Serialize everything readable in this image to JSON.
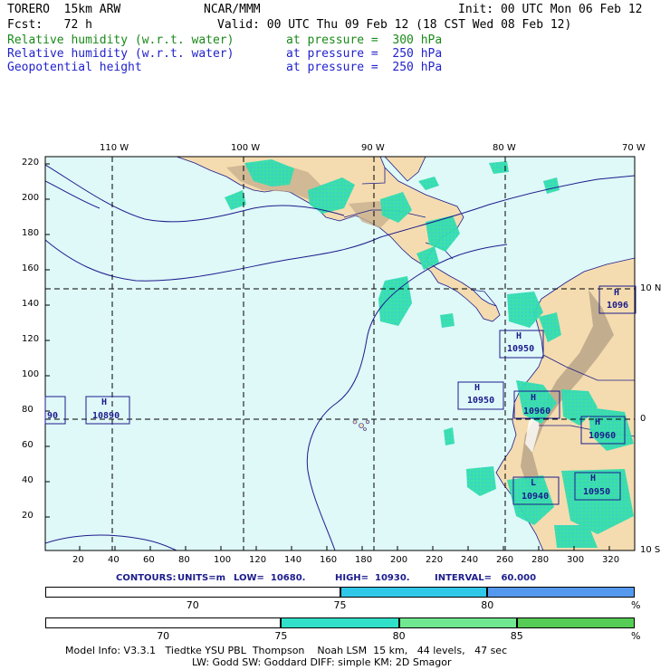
{
  "header": {
    "model": "TORERO  15km ARW",
    "org": "NCAR/MMM",
    "init": "Init: 00 UTC Mon 06 Feb 12",
    "fcst": "Fcst:   72 h",
    "valid": "Valid: 00 UTC Thu 09 Feb 12 (18 CST Wed 08 Feb 12)",
    "fields": [
      {
        "name": "Relative humidity (w.r.t. water)",
        "level": "at pressure =  300 hPa",
        "color": "#1a8a1a"
      },
      {
        "name": "Relative humidity (w.r.t. water)",
        "level": "at pressure =  250 hPa",
        "color": "#2222cc"
      },
      {
        "name": "Geopotential height",
        "level": "at pressure =  250 hPa",
        "color": "#2222cc"
      }
    ]
  },
  "map": {
    "top_lon_labels": [
      "110 W",
      "100 W",
      "90 W",
      "80 W",
      "70 W"
    ],
    "right_lat_labels": [
      "10 N",
      "0",
      "10 S"
    ],
    "y_ticks": [
      "220",
      "200",
      "180",
      "160",
      "140",
      "120",
      "100",
      "80",
      "60",
      "40",
      "20"
    ],
    "x_ticks": [
      "20",
      "40",
      "60",
      "80",
      "100",
      "120",
      "140",
      "160",
      "180",
      "200",
      "220",
      "240",
      "260",
      "280",
      "300",
      "320"
    ],
    "colors": {
      "ocean": "#dff8f8",
      "land": "#f4dcb0",
      "rh_green": "#33e0a8",
      "rh_cyan": "#30d0e0",
      "contour": "#1c1c8c"
    },
    "centers": [
      {
        "label": "H",
        "value": "10950"
      },
      {
        "label": "H",
        "value": "10950"
      },
      {
        "label": "H",
        "value": "10960"
      },
      {
        "label": "H",
        "value": "10960"
      },
      {
        "label": "H",
        "value": "10950"
      },
      {
        "label": "L",
        "value": "10940"
      },
      {
        "label": "H",
        "value": "10890"
      },
      {
        "label": "H",
        "value": "1096"
      },
      {
        "label": "",
        "value": "90"
      }
    ]
  },
  "contours": {
    "label": "CONTOURS:",
    "units": "UNITS=m",
    "low": "LOW=  10680.",
    "high": "HIGH=  10930.",
    "interval": "INTERVAL=   60.000"
  },
  "colorbars": [
    {
      "ticks": [
        "70",
        "75",
        "80"
      ],
      "unit": "%",
      "colors": [
        "#ffffff",
        "#30c8e8",
        "#5599ee"
      ],
      "fractions": [
        0.5,
        0.25,
        0.25
      ]
    },
    {
      "ticks": [
        "70",
        "75",
        "80",
        "85"
      ],
      "unit": "%",
      "colors": [
        "#ffffff",
        "#30e0c8",
        "#70e890",
        "#55cc55"
      ],
      "fractions": [
        0.4,
        0.2,
        0.2,
        0.2
      ]
    }
  ],
  "footer": {
    "line1": "Model Info: V3.3.1   Tiedtke YSU PBL  Thompson    Noah LSM  15 km,   44 levels,   47 sec",
    "line2": "LW: Godd SW: Goddard DIFF: simple KM: 2D Smagor"
  }
}
